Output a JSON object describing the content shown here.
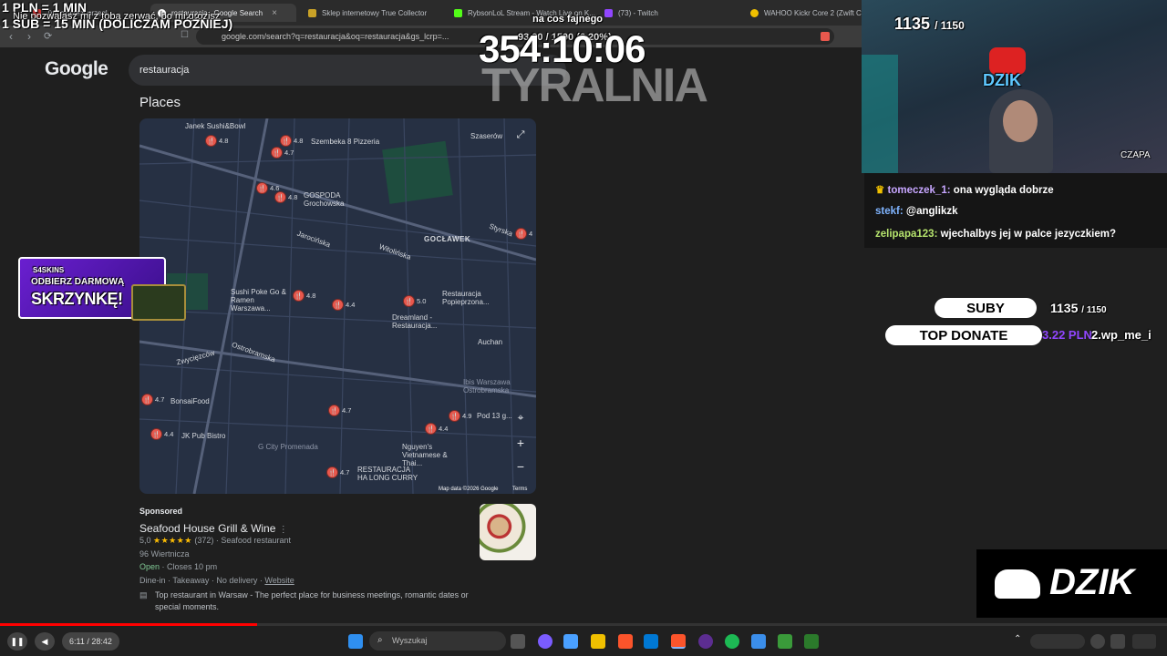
{
  "browser": {
    "tabs": [
      {
        "label": "Tymczasem przegl...",
        "active": false
      },
      {
        "label": "restauracja - Google Search",
        "active": true
      },
      {
        "label": "Sklep internetowy True Collector",
        "active": false
      },
      {
        "label": "RybsonLoL Stream - Watch Live on K...",
        "active": false
      },
      {
        "label": "(73) - Twitch",
        "active": false
      },
      {
        "label": "WAHOO Kickr Core 2 (Zwift Cor...",
        "active": false
      }
    ],
    "url": "google.com/search?q=restauracja&oq=restauracja&gs_lcrp=..."
  },
  "google": {
    "logo": "Google",
    "query": "restauracja",
    "places_heading": "Places"
  },
  "map": {
    "labels": [
      "Janek Sushi&Bowl",
      "Szembeka 8 Pizzeria",
      "Szaserów",
      "GOSPODA Grochowska",
      "GOCŁAWEK",
      "Jarocińska",
      "Witolińska",
      "Styrska",
      "Sushi Poke Go & Ramen Warszawa...",
      "Restauracja Popieprzona...",
      "Dreamland - Restauracja...",
      "Zwycięzców",
      "Auchan",
      "Ostrobramska",
      "Ibis Warszawa Ostrobramska",
      "BonsaiFood",
      "Pod 13 g...",
      "JK Pub Bistro",
      "G City Promenada",
      "Nguyen's Vietnamese & Thai...",
      "RESTAURACJA HA LONG CURRY"
    ],
    "ratings": [
      "4.8",
      "4.8",
      "4.7",
      "4.6",
      "4.8",
      "4",
      "4.8",
      "4.4",
      "5.0",
      "4.7",
      "4.7",
      "4.9",
      "4.4",
      "4.4",
      "4.7"
    ],
    "attribution": "Map data ©2026 Google",
    "terms": "Terms"
  },
  "ad": {
    "sponsored": "Sponsored",
    "title": "Seafood House Grill & Wine",
    "rating": "5,0",
    "stars": "★★★★★",
    "reviews": "(372)",
    "category": "Seafood restaurant",
    "address": "96 Wiertnicza",
    "open": "Open",
    "closes": "· Closes 10 pm",
    "options": "Dine-in · Takeaway · No delivery ·",
    "website": "Website",
    "description": "Top restaurant in Warsaw - The perfect place for business meetings, romantic dates or special moments."
  },
  "overlay": {
    "pln_rule": "1 PLN = 1 MIN",
    "nie_text": "Nie pozwalasz mi z tobą zerwać, bo mi grozisz",
    "sub_rule": "1 SUB = 15 MIN (DOLICZAM PÓŹNIEJ)",
    "na_cos": "na cos fajnego",
    "progress_text": "93,00 / 1500 (6.20%)",
    "timer": "354:10:06",
    "tyralnia": "TYRALNIA",
    "sub_count": "1135",
    "sub_goal": "/ 1150",
    "dzik": "DZIK",
    "czapa": "CZAPA",
    "skins_brand": "S4SKINS",
    "promo_line1": "ODBIERZ DARMOWĄ",
    "promo_line2": "SKRZYNKĘ!",
    "suby_label": "SUBY",
    "suby_value": "1135",
    "suby_goal": "/ 1150",
    "top_donate_label": "TOP DONATE",
    "top_donate_value": "3.22 PLN",
    "top_donate_user": "2.wp_me_i"
  },
  "chat": [
    {
      "user": "tomeczek_1:",
      "message": "ona wygląda dobrze",
      "color": "#c7a6ff"
    },
    {
      "user": "stekf:",
      "message": "@anglikzk",
      "color": "#7fb4ff"
    },
    {
      "user": "zelipapa123:",
      "message": "wjechalbys jej w palce jezyczkiem?",
      "color": "#b6e46d"
    }
  ],
  "player": {
    "time": "6:11 / 28:42",
    "progress": 0.22
  },
  "taskbar": {
    "search_placeholder": "Wyszukaj"
  }
}
